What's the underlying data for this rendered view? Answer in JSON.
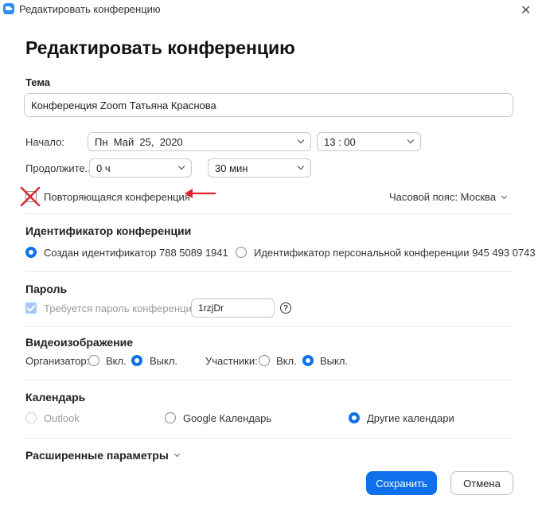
{
  "window": {
    "title": "Редактировать конференцию",
    "close_glyph": "✕"
  },
  "heading": "Редактировать конференцию",
  "topic": {
    "label": "Тема",
    "value": "Конференция Zoom Татьяна Краснова"
  },
  "start": {
    "label": "Начало:",
    "date": "Пн  Май  25,  2020",
    "time": "13 : 00"
  },
  "duration": {
    "label": "Продолжите...",
    "hours": "0 ч",
    "minutes": "30 мин"
  },
  "recurring": {
    "label": "Повторяющаяся конференция",
    "annotation_color": "#e0242b"
  },
  "timezone": {
    "label": "Часовой пояс: Москва"
  },
  "meeting_id": {
    "section_label": "Идентификатор конференции",
    "generated_label": "Создан идентификатор 788 5089 1941",
    "personal_label": "Идентификатор персональной конференции 945 493 0743"
  },
  "password": {
    "section_label": "Пароль",
    "checkbox_label": "Требуется пароль конференции",
    "value": "1rzjDr",
    "help_glyph": "?"
  },
  "video": {
    "section_label": "Видеоизображение",
    "host_label": "Организатор:",
    "participants_label": "Участники:",
    "on_label": "Вкл.",
    "off_label": "Выкл."
  },
  "calendar": {
    "section_label": "Календарь",
    "outlook": "Outlook",
    "google": "Google Календарь",
    "other": "Другие календари"
  },
  "advanced": {
    "label": "Расширенные параметры"
  },
  "buttons": {
    "save": "Сохранить",
    "cancel": "Отмена"
  },
  "colors": {
    "accent": "#0E71EB"
  }
}
